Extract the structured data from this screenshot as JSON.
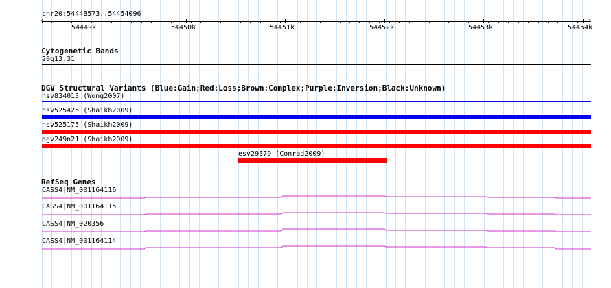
{
  "ruler": {
    "location": "chr20:54448573..54454096",
    "tick_labels": [
      "54449k",
      "54450k",
      "54451k",
      "54452k",
      "54453k",
      "54454k"
    ]
  },
  "cytobands": {
    "title": "Cytogenetic Bands",
    "band": "20q13.31"
  },
  "dgv": {
    "title": "DGV Structural Variants (Blue:Gain;Red:Loss;Brown:Complex;Purple:Inversion;Black:Unknown)",
    "colors": {
      "gain": "#0000ee",
      "loss": "#ff0000",
      "unknown": "#000000"
    },
    "variants": [
      {
        "label": "nsv834013 (Wong2007)",
        "type": "unknown"
      },
      {
        "label": "nsv525425 (Shaikh2009)",
        "type": "gain"
      },
      {
        "label": "nsv525175 (Shaikh2009)",
        "type": "loss"
      },
      {
        "label": "dgv249n21 (Shaikh2009)",
        "type": "loss"
      },
      {
        "label": "esv29379 (Conrad2009)",
        "type": "loss"
      }
    ]
  },
  "refseq": {
    "title": "RefSeq Genes",
    "color": "#cc33cc",
    "genes": [
      {
        "label": "CASS4|NM_001164116"
      },
      {
        "label": "CASS4|NM_001164115"
      },
      {
        "label": "CASS4|NM_020356"
      },
      {
        "label": "CASS4|NM_001164114"
      }
    ]
  }
}
